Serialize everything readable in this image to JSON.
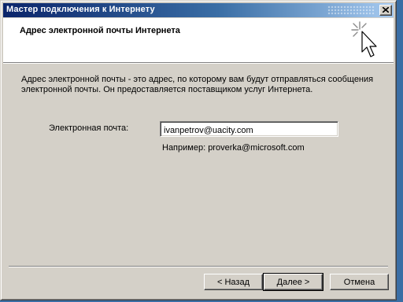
{
  "window": {
    "title": "Мастер подключения к Интернету"
  },
  "header": {
    "title": "Адрес электронной почты Интернета"
  },
  "content": {
    "description": "Адрес электронной почты - это адрес, по которому вам будут отправляться сообщения электронной почты. Он предоставляется поставщиком услуг Интернета.",
    "email_label": "Электронная почта:",
    "email_value": "ivanpetrov@uacity.com",
    "example": "Например: proverka@microsoft.com"
  },
  "buttons": {
    "back": "< Назад",
    "next": "Далее >",
    "cancel": "Отмена"
  },
  "icons": {
    "close": "close-icon",
    "wizard": "wizard-cursor-icon"
  },
  "colors": {
    "dialog_bg": "#d4d0c8",
    "titlebar_start": "#0a246a",
    "titlebar_end": "#a6caf0",
    "header_bg": "#ffffff"
  }
}
